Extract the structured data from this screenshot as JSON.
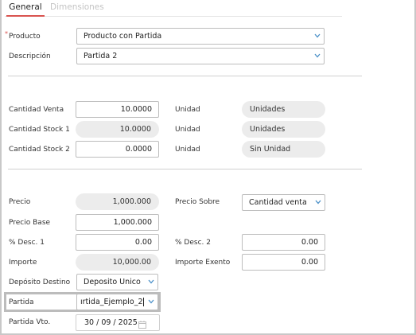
{
  "tabs": [
    {
      "label": "General",
      "active": true
    },
    {
      "label": "Dimensiones",
      "active": false
    }
  ],
  "form": {
    "producto": {
      "label": "Producto",
      "value": "Producto con Partida"
    },
    "descripcion": {
      "label": "Descripción",
      "value": "Partida 2"
    },
    "cantidad_venta": {
      "label": "Cantidad Venta",
      "value": "10.0000"
    },
    "cantidad_stock1": {
      "label": "Cantidad Stock 1",
      "value": "10.0000"
    },
    "cantidad_stock2": {
      "label": "Cantidad Stock 2",
      "value": "0.0000"
    },
    "unidad1": {
      "label": "Unidad",
      "value": "Unidades"
    },
    "unidad2": {
      "label": "Unidad",
      "value": "Unidades"
    },
    "unidad3": {
      "label": "Unidad",
      "value": "Sin Unidad"
    },
    "precio": {
      "label": "Precio",
      "value": "1,000.000"
    },
    "precio_sobre": {
      "label": "Precio Sobre",
      "value": "Cantidad venta"
    },
    "precio_base": {
      "label": "Precio Base",
      "value": "1,000.000"
    },
    "desc1": {
      "label": "% Desc. 1",
      "value": "0.00"
    },
    "desc2": {
      "label": "% Desc. 2",
      "value": "0.00"
    },
    "importe": {
      "label": "Importe",
      "value": "10,000.00"
    },
    "importe_exento": {
      "label": "Importe Exento",
      "value": "0.00"
    },
    "deposito_destino": {
      "label": "Depósito Destino",
      "value": "Deposito Unico"
    },
    "partida": {
      "label": "Partida",
      "value": "ırtida_Ejemplo_2"
    },
    "partida_vto": {
      "label": "Partida Vto.",
      "value": "30 / 09 / 2025"
    }
  },
  "colors": {
    "accent": "#d9534f",
    "chevron": "#4a90c8"
  }
}
